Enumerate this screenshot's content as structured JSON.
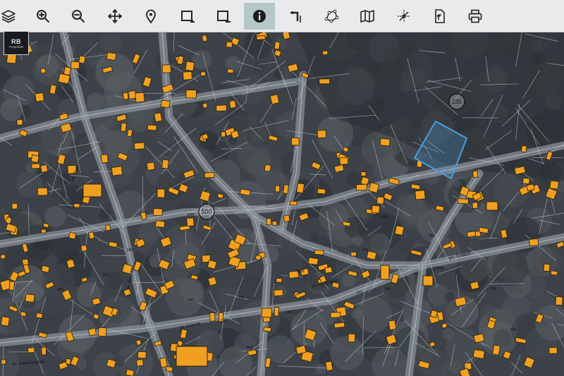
{
  "toolbar": {
    "tools": [
      {
        "name": "layers-icon",
        "label": "Layers"
      },
      {
        "name": "zoom-in-icon",
        "label": "Zoom in"
      },
      {
        "name": "zoom-out-icon",
        "label": "Zoom out"
      },
      {
        "name": "pan-icon",
        "label": "Pan"
      },
      {
        "name": "location-pin-icon",
        "label": "Locate"
      },
      {
        "name": "select-rectangle-add-icon",
        "label": "Select area"
      },
      {
        "name": "select-rectangle-remove-icon",
        "label": "Deselect area"
      },
      {
        "name": "info-icon",
        "label": "Identify",
        "active": true
      },
      {
        "name": "measure-distance-icon",
        "label": "Measure distance"
      },
      {
        "name": "measure-polygon-icon",
        "label": "Measure area"
      },
      {
        "name": "map-icon",
        "label": "Base map"
      },
      {
        "name": "coordinates-icon",
        "label": "Coordinates"
      },
      {
        "name": "export-icon",
        "label": "Export"
      },
      {
        "name": "print-icon",
        "label": "Print"
      }
    ]
  },
  "logo": {
    "mark": "RB",
    "sub": "Properties"
  },
  "map": {
    "parcel_labels": [
      {
        "text": "235",
        "circled": true
      },
      {
        "text": "500",
        "circled": true
      },
      {
        "text": "ул. Спасо..."
      },
      {
        "text": "ул. Спасов"
      },
      {
        "text": "ул. Спасовска"
      },
      {
        "text": "ул. Александров"
      },
      {
        "text": "ул. Иван Вазов"
      },
      {
        "text": "ул. Лале"
      },
      {
        "text": "1616"
      },
      {
        "text": "1640"
      },
      {
        "text": "1137"
      },
      {
        "text": "1658"
      },
      {
        "text": "1649"
      },
      {
        "text": "854"
      },
      {
        "text": "784"
      },
      {
        "text": "740"
      },
      {
        "text": "697"
      },
      {
        "text": "874"
      },
      {
        "text": "880"
      },
      {
        "text": "846"
      },
      {
        "text": "843"
      },
      {
        "text": "785"
      },
      {
        "text": "726"
      },
      {
        "text": "671"
      },
      {
        "text": "665"
      },
      {
        "text": "682"
      }
    ],
    "colors": {
      "background": "#3d4249",
      "building": "#f0a020",
      "building_outline": "#2a1e0a",
      "parcel_line": "#c8d2dc",
      "road": "#b8bcc2",
      "highlight": "#4a9ee0"
    }
  }
}
